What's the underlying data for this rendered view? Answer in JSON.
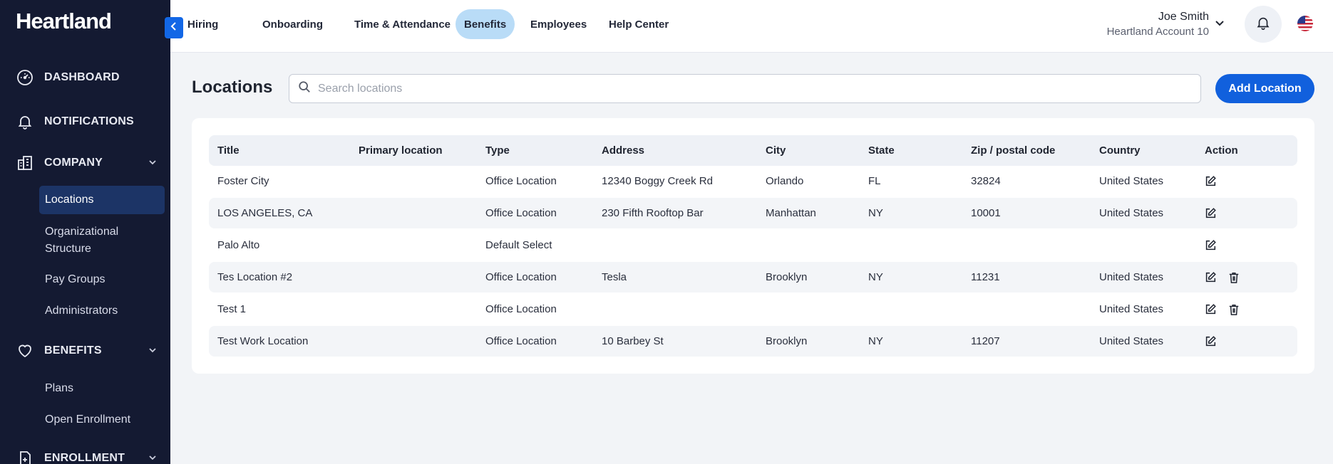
{
  "sidebar": {
    "logo": "Heartland",
    "items": [
      {
        "label": "DASHBOARD",
        "icon": "dashboard-gauge-icon"
      },
      {
        "label": "NOTIFICATIONS",
        "icon": "bell-icon"
      },
      {
        "label": "COMPANY",
        "icon": "company-building-icon",
        "expanded": true
      },
      {
        "label": "BENEFITS",
        "icon": "heart-icon",
        "expanded": true
      },
      {
        "label": "ENROLLMENT",
        "icon": "enrollment-doc-icon"
      }
    ],
    "company_sub": [
      "Locations",
      "Organizational Structure",
      "Pay Groups",
      "Administrators"
    ],
    "benefits_sub": [
      "Plans",
      "Open Enrollment"
    ],
    "active_sub": "Locations"
  },
  "topnav": {
    "tabs": [
      "Hiring",
      "Onboarding",
      "Time & Attendance",
      "Benefits",
      "Employees",
      "Help Center"
    ],
    "active_tab": "Benefits",
    "user_name": "Joe Smith",
    "account": "Heartland Account 10",
    "locale_flag": "us-flag-icon"
  },
  "page": {
    "title": "Locations",
    "search_placeholder": "Search locations",
    "add_button": "Add Location"
  },
  "table": {
    "columns": [
      "Title",
      "Primary location",
      "Type",
      "Address",
      "City",
      "State",
      "Zip / postal code",
      "Country",
      "Action"
    ],
    "rows": [
      {
        "title": "Foster City",
        "primary": "",
        "type": "Office Location",
        "address": "12340 Boggy Creek Rd",
        "city": "Orlando",
        "state": "FL",
        "zip": "32824",
        "country": "United States",
        "can_delete": false
      },
      {
        "title": "LOS ANGELES, CA",
        "primary": "",
        "type": "Office Location",
        "address": "230 Fifth Rooftop Bar",
        "city": "Manhattan",
        "state": "NY",
        "zip": "10001",
        "country": "United States",
        "can_delete": false
      },
      {
        "title": "Palo Alto",
        "primary": "",
        "type": "Default Select",
        "address": "",
        "city": "",
        "state": "",
        "zip": "",
        "country": "",
        "can_delete": false
      },
      {
        "title": "Tes Location #2",
        "primary": "",
        "type": "Office Location",
        "address": "Tesla",
        "city": "Brooklyn",
        "state": "NY",
        "zip": "11231",
        "country": "United States",
        "can_delete": true
      },
      {
        "title": "Test 1",
        "primary": "",
        "type": "Office Location",
        "address": "",
        "city": "",
        "state": "",
        "zip": "",
        "country": "United States",
        "can_delete": true
      },
      {
        "title": "Test Work Location",
        "primary": "",
        "type": "Office Location",
        "address": "10 Barbey St",
        "city": "Brooklyn",
        "state": "NY",
        "zip": "11207",
        "country": "United States",
        "can_delete": false
      }
    ]
  },
  "colors": {
    "sidebar_bg": "#141a32",
    "accent": "#1160dd",
    "active_tab_bg": "#b9dcf7",
    "active_sub_bg": "#1c3466"
  }
}
